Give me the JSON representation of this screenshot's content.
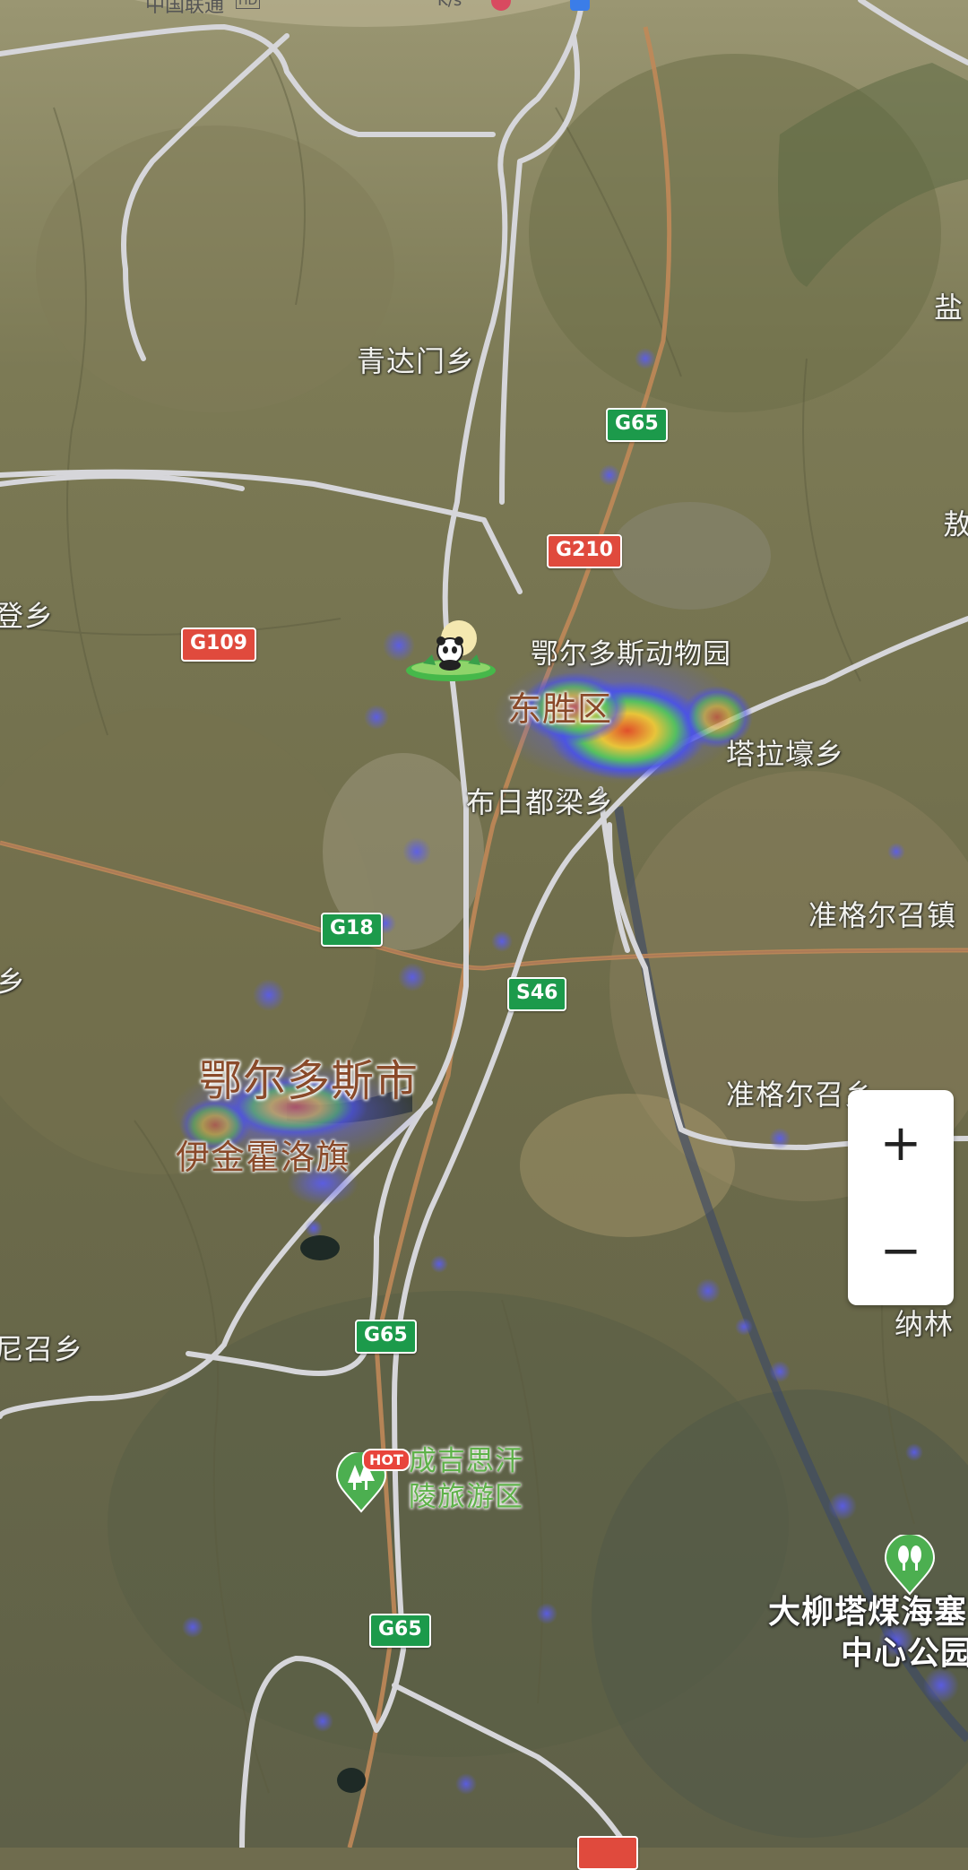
{
  "status_bar": {
    "carrier": "中国联通",
    "hd_badge": "HD",
    "speed_unit": "K/s"
  },
  "map": {
    "type": "satellite",
    "labels": {
      "qingdamen": "青达门乡",
      "yan_edge": "盐",
      "hao_edge": "敖",
      "deng": "登乡",
      "zoo": "鄂尔多斯动物园",
      "dongsheng": "东胜区",
      "talahao": "塔拉壕乡",
      "burdu": "布日都梁乡",
      "zhungeer_town": "准格尔召镇",
      "xiang_edge": "i乡",
      "ordos_city": "鄂尔多斯市",
      "yijinhuoluo": "伊金霍洛旗",
      "zhungeer_xiang": "准格尔召乡",
      "ni_zhao": "尼召乡",
      "nalin": "纳林",
      "genghis_line1": "成吉思汗",
      "genghis_line2": "陵旅游区",
      "daliuta_line1": "大柳塔煤海塞",
      "daliuta_line2": "中心公园"
    },
    "shields": {
      "g65_a": "G65",
      "g210": "G210",
      "g109": "G109",
      "g18": "G18",
      "s46": "S46",
      "g65_b": "G65",
      "g65_c": "G65"
    },
    "hot_badge": "HOT",
    "icons": [
      "panda-zoo-icon",
      "tree-pin-icon",
      "park-pin-icon"
    ],
    "colors": {
      "highway_green": "#1c9a4b",
      "national_road_red": "#e04a3d",
      "heat_blue": "#5a5cf0",
      "heat_red": "#e0502a"
    }
  },
  "zoom": {
    "in_label": "+",
    "out_label": "−"
  }
}
